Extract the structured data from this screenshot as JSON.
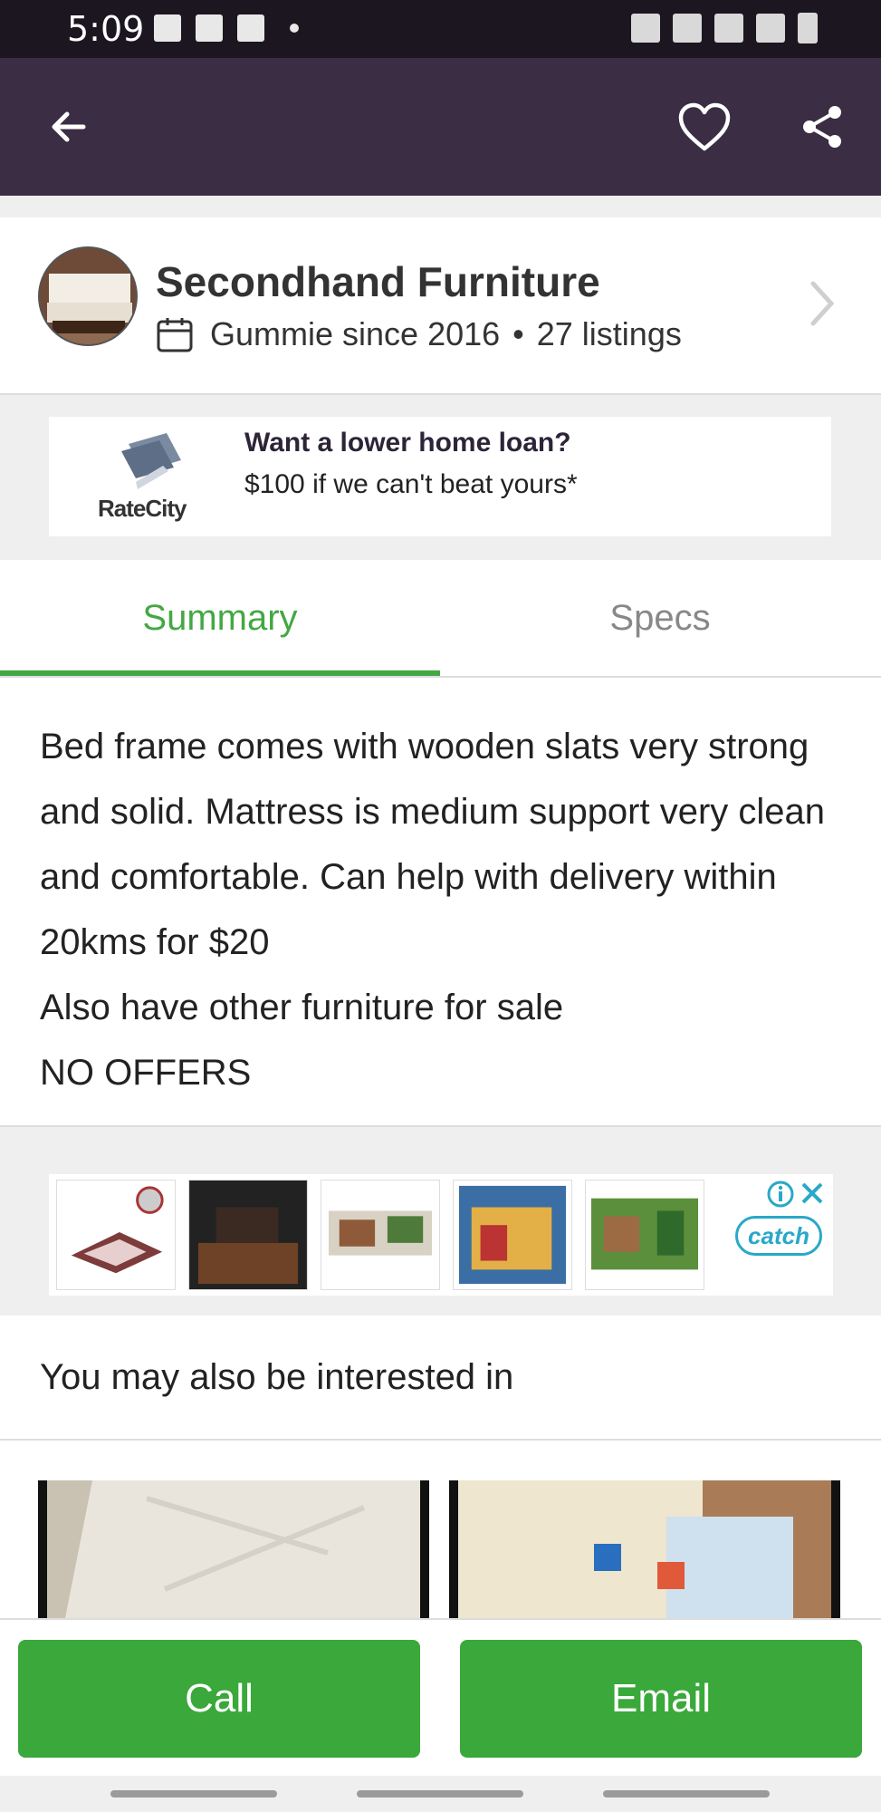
{
  "status_bar": {
    "time": "5:09"
  },
  "seller": {
    "name": "Secondhand Furniture",
    "since": "Gummie since 2016",
    "bullet": "•",
    "listings": "27 listings"
  },
  "ad_banner": {
    "brand": "RateCity",
    "headline": "Want a lower home loan?",
    "subline": "$100 if we can't beat yours*"
  },
  "tabs": [
    {
      "label": "Summary",
      "active": true
    },
    {
      "label": "Specs",
      "active": false
    }
  ],
  "description": "Bed frame comes with wooden slats very strong and solid. Mattress is medium support very clean and comfortable. Can help with delivery within 20kms for $20\nAlso have other furniture for sale\nNO OFFERS",
  "product_ad": {
    "brand": "catch"
  },
  "related": {
    "title": "You may also be interested in"
  },
  "actions": {
    "call": "Call",
    "email": "Email"
  },
  "colors": {
    "accent": "#43a843",
    "appbar": "#3b2d43",
    "statusbar": "#1c1620",
    "button": "#3aa83a"
  }
}
